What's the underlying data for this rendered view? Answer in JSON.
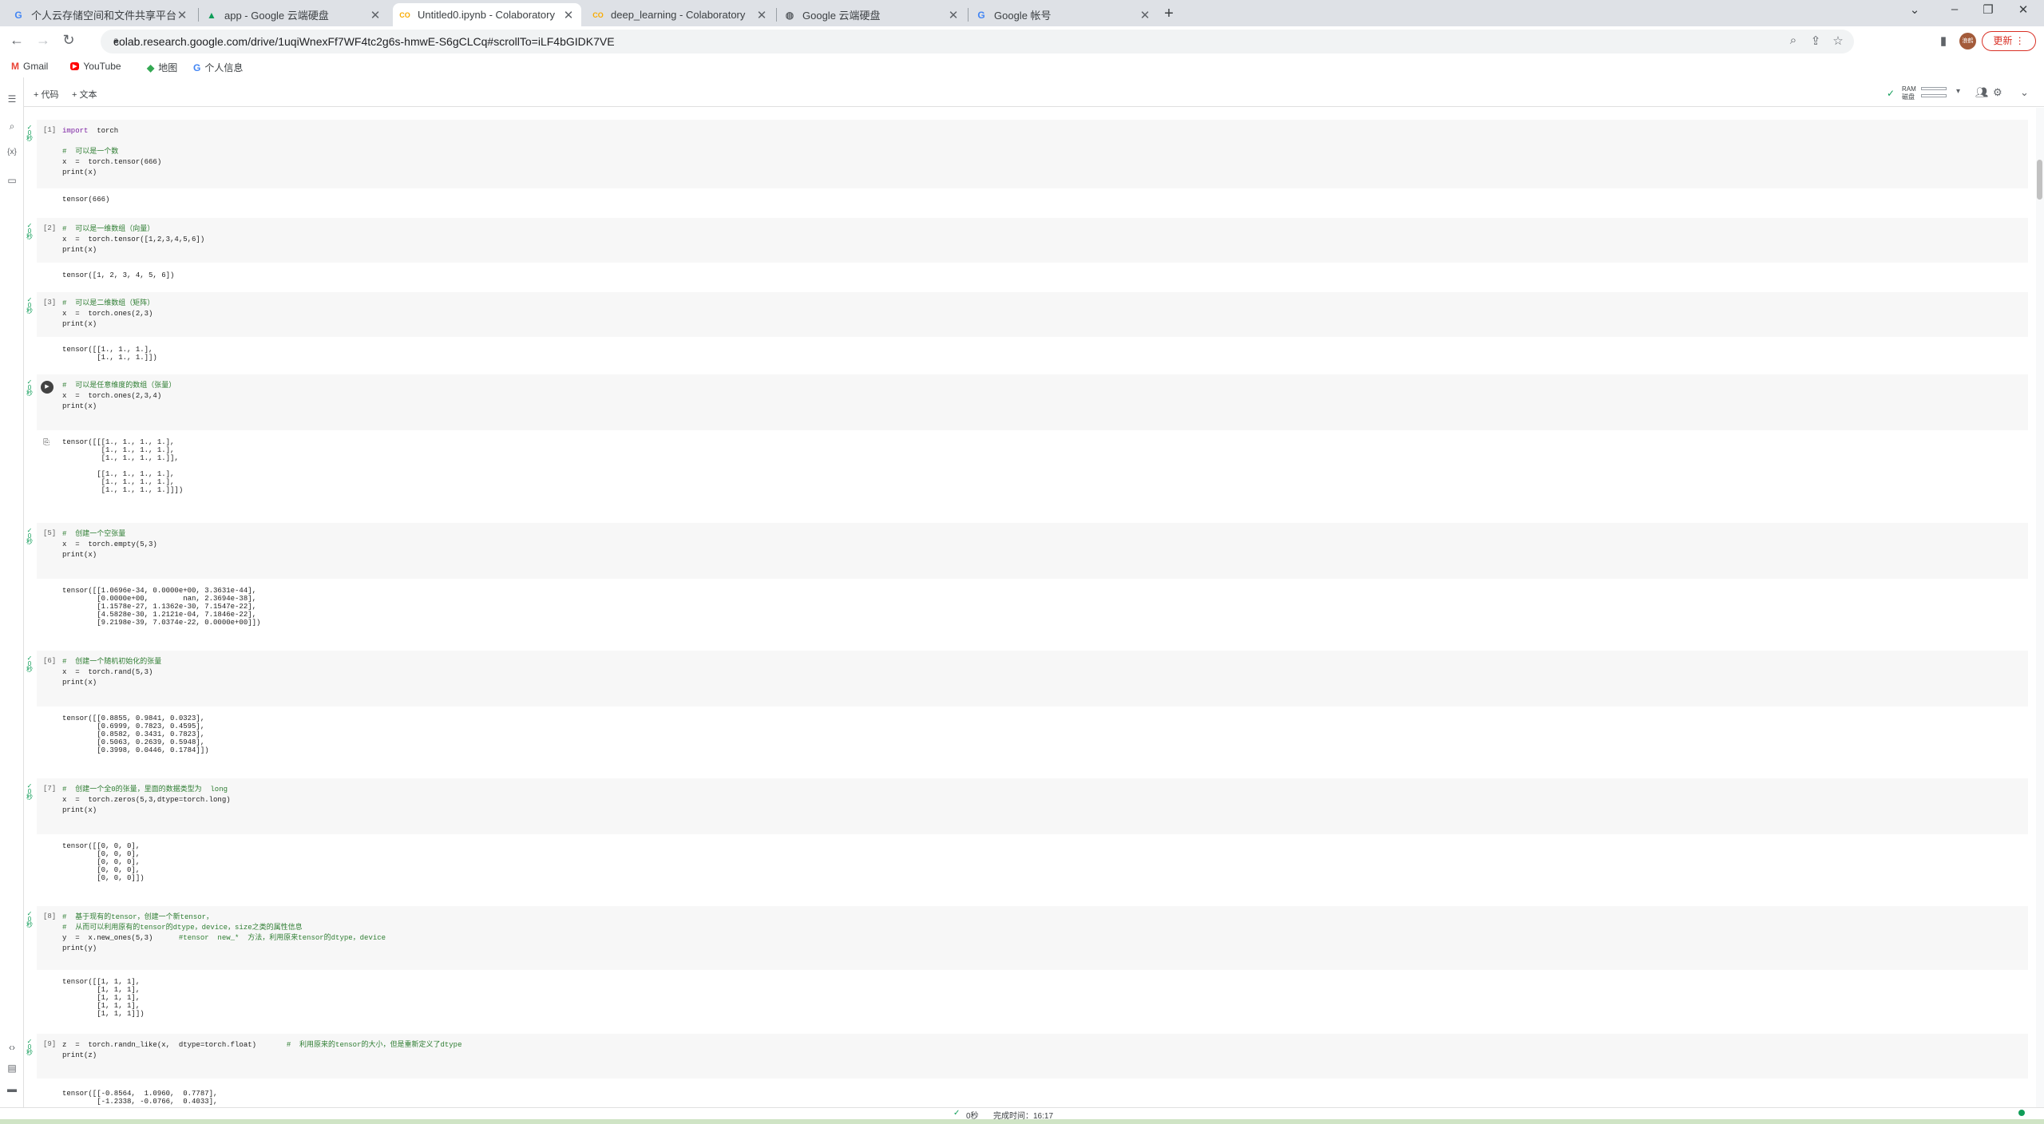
{
  "tabs": [
    {
      "title": "个人云存储空间和文件共享平台",
      "favicon": "G"
    },
    {
      "title": "app - Google 云端硬盘",
      "favicon": "drive-icon"
    },
    {
      "title": "Untitled0.ipynb - Colaboratory",
      "favicon": "CO"
    },
    {
      "title": "deep_learning - Colaboratory",
      "favicon": "CO"
    },
    {
      "title": "Google 云端硬盘",
      "favicon": "globe-icon"
    },
    {
      "title": "Google 帐号",
      "favicon": "G"
    }
  ],
  "url": "colab.research.google.com/drive/1uqiWnexFf7WF4tc2g6s-hmwE-S6gCLCq#scrollTo=iLF4bGIDK7VE",
  "profile_initials": "浪鹤",
  "update_label": "更新",
  "bookmarks": [
    {
      "label": "Gmail",
      "icon": "M"
    },
    {
      "label": "YouTube",
      "icon": "▶"
    },
    {
      "label": "地图",
      "icon": "◆"
    },
    {
      "label": "个人信息",
      "icon": "G"
    }
  ],
  "colab": {
    "add_code": "+ 代码",
    "add_text": "+ 文本",
    "ram": "RAM",
    "disk": "磁盘"
  },
  "cells": [
    {
      "num": "[1]",
      "lines": [
        {
          "t": "import  torch",
          "k": "kw"
        },
        {
          "t": "",
          "k": ""
        },
        {
          "t": "#  可以是一个数",
          "k": "cm"
        },
        {
          "t": "x  =  torch.tensor(666)",
          "k": ""
        },
        {
          "t": "print(x)",
          "k": ""
        }
      ],
      "output": "tensor(666)"
    },
    {
      "num": "[2]",
      "lines": [
        {
          "t": "#  可以是一维数组（向量）",
          "k": "cm"
        },
        {
          "t": "x  =  torch.tensor([1,2,3,4,5,6])",
          "k": ""
        },
        {
          "t": "print(x)",
          "k": ""
        }
      ],
      "output": "tensor([1, 2, 3, 4, 5, 6])"
    },
    {
      "num": "[3]",
      "lines": [
        {
          "t": "#  可以是二维数组（矩阵）",
          "k": "cm"
        },
        {
          "t": "x  =  torch.ones(2,3)",
          "k": ""
        },
        {
          "t": "print(x)",
          "k": ""
        }
      ],
      "output": "tensor([[1., 1., 1.],\n        [1., 1., 1.]])"
    },
    {
      "num": "",
      "lines": [
        {
          "t": "#  可以是任意维度的数组（张量）",
          "k": "cm"
        },
        {
          "t": "x  =  torch.ones(2,3,4)",
          "k": ""
        },
        {
          "t": "print(x)",
          "k": ""
        }
      ],
      "output": "tensor([[[1., 1., 1., 1.],\n         [1., 1., 1., 1.],\n         [1., 1., 1., 1.]],\n\n        [[1., 1., 1., 1.],\n         [1., 1., 1., 1.],\n         [1., 1., 1., 1.]]])"
    },
    {
      "num": "[5]",
      "lines": [
        {
          "t": "#  创建一个空张量",
          "k": "cm"
        },
        {
          "t": "x  =  torch.empty(5,3)",
          "k": ""
        },
        {
          "t": "print(x)",
          "k": ""
        }
      ],
      "output": "tensor([[1.0696e-34, 0.0000e+00, 3.3631e-44],\n        [0.0000e+00,        nan, 2.3694e-38],\n        [1.1578e-27, 1.1362e-30, 7.1547e-22],\n        [4.5828e-30, 1.2121e-04, 7.1846e-22],\n        [9.2198e-39, 7.0374e-22, 0.0000e+00]])"
    },
    {
      "num": "[6]",
      "lines": [
        {
          "t": "#  创建一个随机初始化的张量",
          "k": "cm"
        },
        {
          "t": "x  =  torch.rand(5,3)",
          "k": ""
        },
        {
          "t": "print(x)",
          "k": ""
        }
      ],
      "output": "tensor([[0.8855, 0.9841, 0.0323],\n        [0.6999, 0.7823, 0.4595],\n        [0.8582, 0.3431, 0.7823],\n        [0.5063, 0.2639, 0.5948],\n        [0.3998, 0.0446, 0.1784]])"
    },
    {
      "num": "[7]",
      "lines": [
        {
          "t": "#  创建一个全0的张量，里面的数据类型为  long",
          "k": "cm"
        },
        {
          "t": "x  =  torch.zeros(5,3,dtype=torch.long)",
          "k": ""
        },
        {
          "t": "print(x)",
          "k": ""
        }
      ],
      "output": "tensor([[0, 0, 0],\n        [0, 0, 0],\n        [0, 0, 0],\n        [0, 0, 0],\n        [0, 0, 0]])"
    },
    {
      "num": "[8]",
      "lines": [
        {
          "t": "#  基于现有的tensor，创建一个新tensor，",
          "k": "cm"
        },
        {
          "t": "#  从而可以利用原有的tensor的dtype，device，size之类的属性信息",
          "k": "cm"
        },
        {
          "t": "y  =  x.new_ones(5,3)      #tensor  new_*  方法，利用原来tensor的dtype，device",
          "k": "mix"
        },
        {
          "t": "print(y)",
          "k": ""
        }
      ],
      "output": "tensor([[1, 1, 1],\n        [1, 1, 1],\n        [1, 1, 1],\n        [1, 1, 1],\n        [1, 1, 1]])"
    },
    {
      "num": "[9]",
      "lines": [
        {
          "t": "z  =  torch.randn_like(x,  dtype=torch.float)       #  利用原来的tensor的大小，但是重新定义了dtype",
          "k": "mix"
        },
        {
          "t": "print(z)",
          "k": ""
        }
      ],
      "output": "tensor([[-0.8564,  1.0960,  0.7787],\n        [-1.2338, -0.0766,  0.4033],"
    }
  ],
  "status": {
    "check": "✓",
    "seconds": "0秒",
    "done": "完成时间：16:17"
  }
}
